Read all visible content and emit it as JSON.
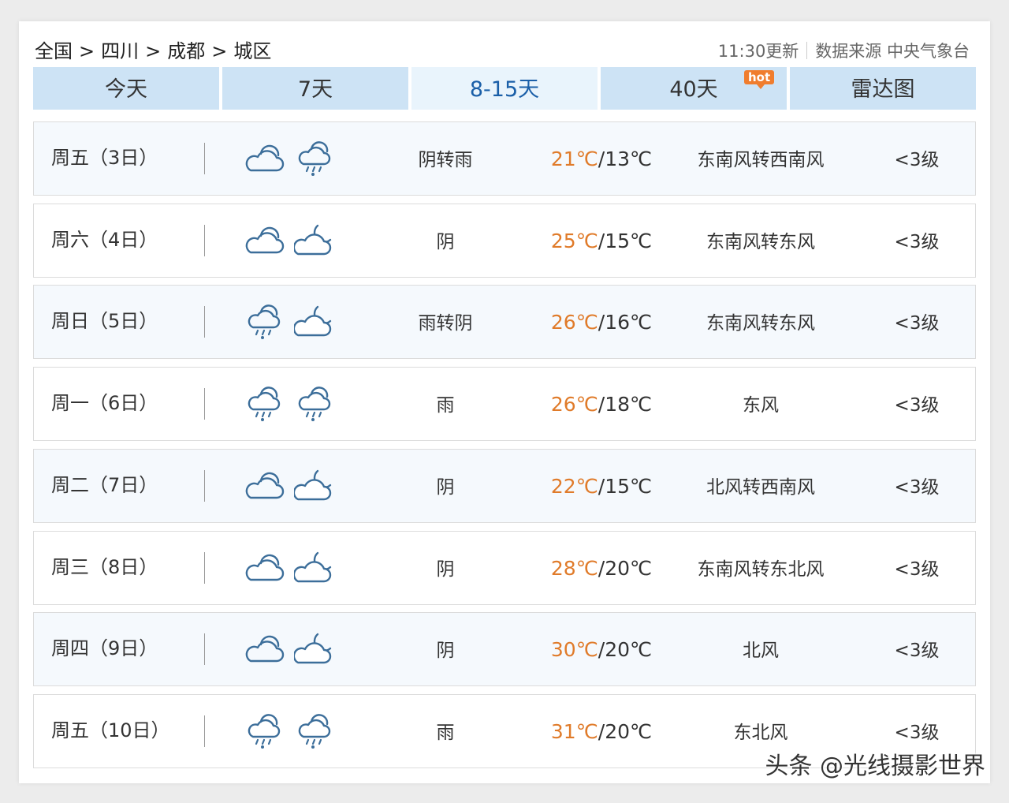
{
  "breadcrumb": {
    "items": [
      "全国",
      "四川",
      "成都",
      "城区"
    ],
    "separator": ">"
  },
  "meta": {
    "updated": "11:30更新",
    "source": "数据来源 中央气象台"
  },
  "tabs": [
    {
      "label": "今天",
      "active": false
    },
    {
      "label": "7天",
      "active": false
    },
    {
      "label": "8-15天",
      "active": true
    },
    {
      "label": "40天",
      "active": false,
      "badge": "hot"
    },
    {
      "label": "雷达图",
      "active": false
    }
  ],
  "forecast": [
    {
      "day": "周五（3日）",
      "icons": [
        "cloudy-icon",
        "rain-icon"
      ],
      "condition": "阴转雨",
      "high": "21℃",
      "low": "/13℃",
      "wind": "东南风转西南风",
      "level": "<3级"
    },
    {
      "day": "周六（4日）",
      "icons": [
        "cloudy-icon",
        "cloudy-night-icon"
      ],
      "condition": "阴",
      "high": "25℃",
      "low": "/15℃",
      "wind": "东南风转东风",
      "level": "<3级"
    },
    {
      "day": "周日（5日）",
      "icons": [
        "rain-icon",
        "cloudy-night-icon"
      ],
      "condition": "雨转阴",
      "high": "26℃",
      "low": "/16℃",
      "wind": "东南风转东风",
      "level": "<3级"
    },
    {
      "day": "周一（6日）",
      "icons": [
        "rain-icon",
        "rain-icon"
      ],
      "condition": "雨",
      "high": "26℃",
      "low": "/18℃",
      "wind": "东风",
      "level": "<3级"
    },
    {
      "day": "周二（7日）",
      "icons": [
        "cloudy-icon",
        "cloudy-night-icon"
      ],
      "condition": "阴",
      "high": "22℃",
      "low": "/15℃",
      "wind": "北风转西南风",
      "level": "<3级"
    },
    {
      "day": "周三（8日）",
      "icons": [
        "cloudy-icon",
        "cloudy-night-icon"
      ],
      "condition": "阴",
      "high": "28℃",
      "low": "/20℃",
      "wind": "东南风转东北风",
      "level": "<3级"
    },
    {
      "day": "周四（9日）",
      "icons": [
        "cloudy-icon",
        "cloudy-night-icon"
      ],
      "condition": "阴",
      "high": "30℃",
      "low": "/20℃",
      "wind": "北风",
      "level": "<3级"
    },
    {
      "day": "周五（10日）",
      "icons": [
        "rain-icon",
        "rain-icon"
      ],
      "condition": "雨",
      "high": "31℃",
      "low": "/20℃",
      "wind": "东北风",
      "level": "<3级"
    }
  ],
  "colors": {
    "tab_bg": "#cde3f5",
    "tab_active_bg": "#e9f4fc",
    "tab_active_text": "#1a5fa8",
    "high_temp": "#e07b2a",
    "icon_stroke": "#3c6e9a",
    "badge": "#f07d2e"
  },
  "watermark": "头条 @光线摄影世界"
}
